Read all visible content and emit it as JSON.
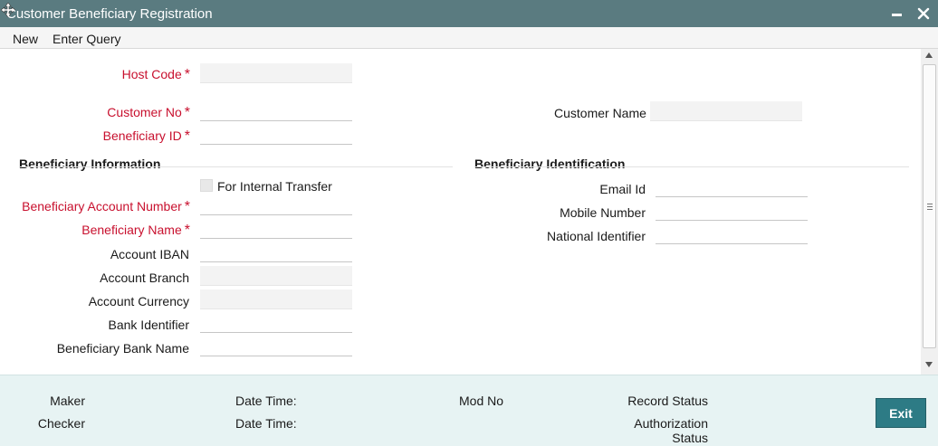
{
  "window": {
    "title": "Customer Beneficiary Registration"
  },
  "menu": {
    "new_label": "New",
    "enter_query_label": "Enter Query"
  },
  "form": {
    "host_code_label": "Host Code",
    "customer_no_label": "Customer No",
    "customer_name_label": "Customer Name",
    "beneficiary_id_label": "Beneficiary ID",
    "required_mark": "*",
    "host_code_value": "",
    "customer_no_value": "",
    "customer_name_value": "",
    "beneficiary_id_value": ""
  },
  "beneficiary_info": {
    "section_title": "Beneficiary Information",
    "internal_transfer_label": "For Internal Transfer",
    "internal_transfer_checked": false,
    "account_number_label": "Beneficiary Account Number",
    "name_label": "Beneficiary Name",
    "iban_label": "Account IBAN",
    "branch_label": "Account Branch",
    "currency_label": "Account Currency",
    "bank_identifier_label": "Bank Identifier",
    "bank_name_label": "Beneficiary Bank Name"
  },
  "beneficiary_identification": {
    "section_title": "Beneficiary Identification",
    "email_label": "Email Id",
    "mobile_label": "Mobile Number",
    "national_id_label": "National Identifier"
  },
  "footer": {
    "maker_label": "Maker",
    "checker_label": "Checker",
    "date_time_label": "Date Time:",
    "mod_no_label": "Mod No",
    "record_status_label": "Record Status",
    "authorization_label": "Authorization",
    "authorization_status_label": "Status",
    "exit_label": "Exit"
  },
  "colors": {
    "titlebar": "#5a7b80",
    "required_label": "#c8102e",
    "footer_bg": "#e7f3f3",
    "exit_button": "#2d7b85"
  },
  "icons": [
    "move-icon",
    "minimize-icon",
    "close-icon",
    "scroll-up-icon",
    "scroll-down-icon"
  ]
}
